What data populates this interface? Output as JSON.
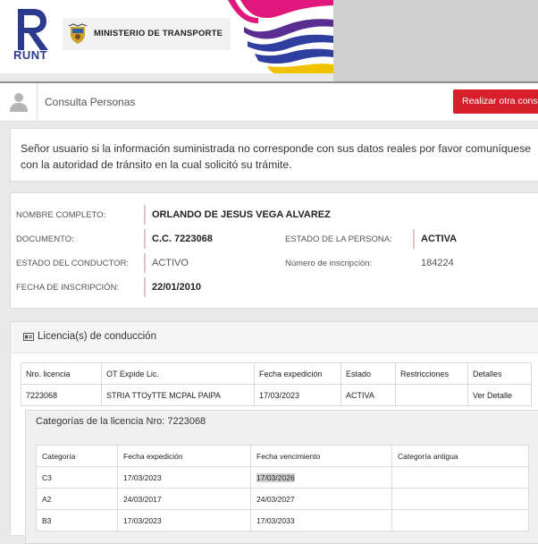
{
  "header": {
    "logo_text": "RUNT",
    "ministry": "MINISTERIO DE TRANSPORTE"
  },
  "consulta": {
    "title": "Consulta Personas",
    "button": "Realizar otra consulta"
  },
  "notice": "Señor usuario si la información suministrada no corresponde con sus datos reales por favor comuníquese con la autoridad de tránsito en la cual solicitó su trámite.",
  "person": {
    "nombre_label": "NOMBRE COMPLETO:",
    "nombre": "ORLANDO DE JESUS VEGA ALVAREZ",
    "documento_label": "DOCUMENTO:",
    "documento": "C.C. 7223068",
    "estado_persona_label": "ESTADO DE LA PERSONA:",
    "estado_persona": "ACTIVA",
    "estado_conductor_label": "ESTADO DEL CONDUCTOR:",
    "estado_conductor": "ACTIVO",
    "inscripcion_num_label": "Número de inscripción:",
    "inscripcion_num": "184224",
    "fecha_inscripcion_label": "FECHA DE INSCRIPCIÓN:",
    "fecha_inscripcion": "22/01/2010"
  },
  "licencias": {
    "title": "Licencia(s) de conducción",
    "headers": [
      "Nro. licencia",
      "OT Expide Lic.",
      "Fecha expedición",
      "Estado",
      "Restricciones",
      "Detalles"
    ],
    "rows": [
      [
        "7223068",
        "STRIA TTOyTTE MCPAL PAIPA",
        "17/03/2023",
        "ACTIVA",
        "",
        "Ver Detalle"
      ]
    ]
  },
  "categorias": {
    "title": "Categorías de la licencia Nro: 7223068",
    "headers": [
      "Categoría",
      "Fecha expedición",
      "Fecha vencimiento",
      "Categoría antigua"
    ],
    "rows": [
      [
        "C3",
        "17/03/2023",
        "17/03/2026",
        ""
      ],
      [
        "A2",
        "24/03/2017",
        "24/03/2027",
        ""
      ],
      [
        "B3",
        "17/03/2023",
        "17/03/2033",
        ""
      ]
    ]
  },
  "colors": {
    "accent_red": "#d71e2b",
    "runt_blue": "#2b3a8f"
  }
}
